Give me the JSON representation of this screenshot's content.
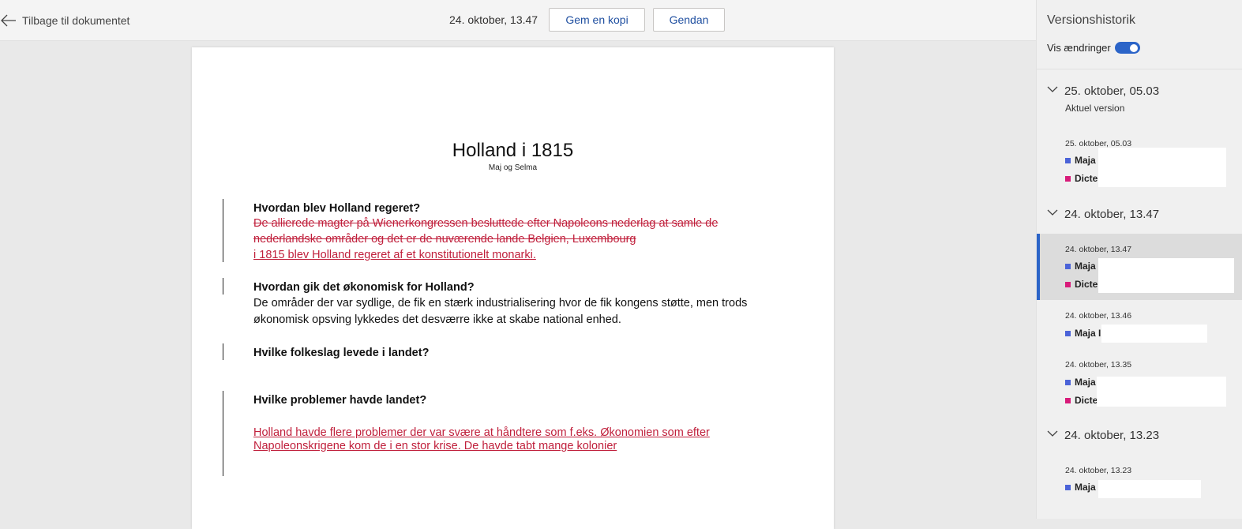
{
  "topbar": {
    "back_label": "Tilbage til dokumentet",
    "timestamp": "24. oktober, 13.47",
    "save_copy_label": "Gem en kopi",
    "restore_label": "Gendan"
  },
  "document": {
    "title": "Holland i 1815",
    "subtitle": "Maj og Selma",
    "sections": [
      {
        "heading": "Hvordan blev Holland regeret?",
        "deleted_line1": "De allierede magter på Wienerkongressen besluttede efter Napoleons nederlag at samle de",
        "deleted_line2": "nederlandske områder og det er de nuværende lande Belgien, Luxembourg",
        "inserted_line": "i 1815 blev Holland regeret af et konstitutionelt monarki."
      },
      {
        "heading": "Hvordan gik det økonomisk for Holland?",
        "body_line1": "De områder der var sydlige, de fik en stærk industrialisering hvor de fik kongens støtte, men trods",
        "body_line2": "økonomisk opsving lykkedes det desværre ikke at skabe national enhed."
      },
      {
        "heading": "Hvilke folkeslag levede i landet?"
      },
      {
        "heading": "Hvilke problemer havde landet?",
        "inserted_line1": "Holland havde flere problemer der var svære at håndtere som f.eks. Økonomien som efter",
        "inserted_line2": "Napoleonskrigene kom de i en stor krise. De havde tabt mange kolonier"
      }
    ]
  },
  "panel": {
    "title": "Versionshistorik",
    "show_changes_label": "Vis ændringer",
    "show_changes_on": true,
    "groups": [
      {
        "label": "25. oktober, 05.03",
        "sublabel": "Aktuel version",
        "entries": [
          {
            "timestamp": "25. oktober, 05.03",
            "authors": [
              "Maja",
              "Dicte"
            ]
          }
        ]
      },
      {
        "label": "24. oktober, 13.47",
        "entries": [
          {
            "timestamp": "24. oktober, 13.47",
            "authors": [
              "Maja",
              "Dicte"
            ],
            "selected": true
          },
          {
            "timestamp": "24. oktober, 13.46",
            "authors": [
              "Maja I"
            ]
          },
          {
            "timestamp": "24. oktober, 13.35",
            "authors": [
              "Maja",
              "Dicte"
            ]
          }
        ]
      },
      {
        "label": "24. oktober, 13.23",
        "entries": [
          {
            "timestamp": "24. oktober, 13.23",
            "authors": [
              "Maja"
            ]
          }
        ]
      }
    ]
  },
  "colors": {
    "accent": "#2b64c8",
    "change_red": "#c0203c",
    "author_maja": "#4b63d8",
    "author_dicte": "#d81b7a"
  }
}
